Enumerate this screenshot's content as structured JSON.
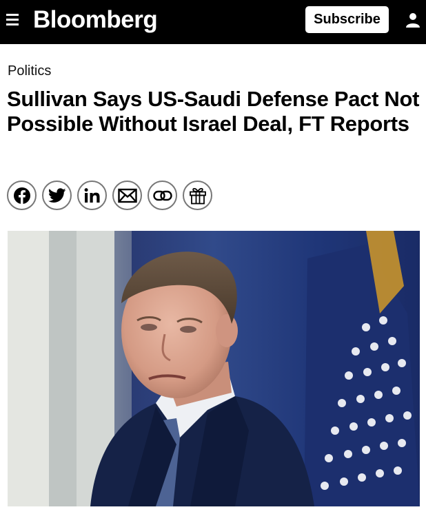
{
  "header": {
    "logo_text": "Bloomberg",
    "subscribe_label": "Subscribe",
    "menu_icon": "hamburger-menu-icon",
    "account_icon": "user-icon"
  },
  "article": {
    "section": "Politics",
    "headline": "Sullivan Says US-Saudi Defense Pact Not Possible Without Israel Deal, FT Reports"
  },
  "share_buttons": [
    {
      "name": "facebook-icon"
    },
    {
      "name": "twitter-icon"
    },
    {
      "name": "linkedin-icon"
    },
    {
      "name": "email-icon"
    },
    {
      "name": "link-icon"
    },
    {
      "name": "gift-icon"
    }
  ],
  "colors": {
    "header_bg": "#000000",
    "header_text": "#ffffff",
    "share_border": "#777777"
  }
}
